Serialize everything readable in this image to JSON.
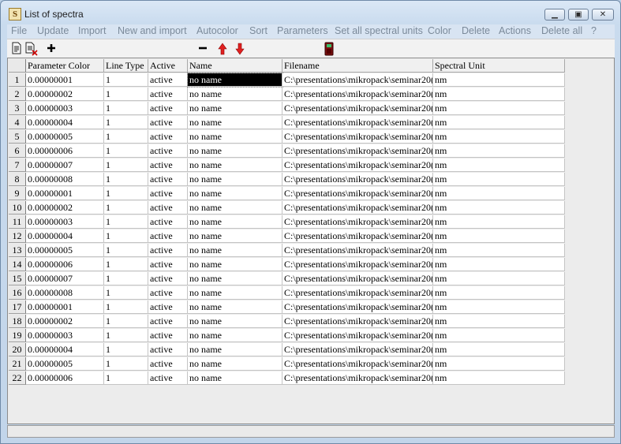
{
  "window": {
    "title": "List of spectra",
    "app_icon_letter": "S"
  },
  "menu": [
    "File",
    "Update",
    "Import",
    "New and import",
    "Autocolor",
    "Sort",
    "Parameters",
    "Set all spectral units",
    "Color",
    "Delete",
    "Actions",
    "Delete all",
    "?"
  ],
  "toolbar": {
    "icons": [
      "new-document-icon",
      "delete-document-icon",
      "add-icon",
      "remove-icon",
      "move-up-icon",
      "move-down-icon",
      "calculator-icon"
    ]
  },
  "table": {
    "headers": [
      "Parameter Color",
      "Line Type",
      "Active",
      "Name",
      "Filename",
      "Spectral Unit"
    ],
    "rows": [
      [
        "1",
        "0.00000001",
        "1",
        "active",
        "no name",
        "C:\\presentations\\mikropack\\seminar20(",
        "nm"
      ],
      [
        "2",
        "0.00000002",
        "1",
        "active",
        "no name",
        "C:\\presentations\\mikropack\\seminar20(",
        "nm"
      ],
      [
        "3",
        "0.00000003",
        "1",
        "active",
        "no name",
        "C:\\presentations\\mikropack\\seminar20(",
        "nm"
      ],
      [
        "4",
        "0.00000004",
        "1",
        "active",
        "no name",
        "C:\\presentations\\mikropack\\seminar20(",
        "nm"
      ],
      [
        "5",
        "0.00000005",
        "1",
        "active",
        "no name",
        "C:\\presentations\\mikropack\\seminar20(",
        "nm"
      ],
      [
        "6",
        "0.00000006",
        "1",
        "active",
        "no name",
        "C:\\presentations\\mikropack\\seminar20(",
        "nm"
      ],
      [
        "7",
        "0.00000007",
        "1",
        "active",
        "no name",
        "C:\\presentations\\mikropack\\seminar20(",
        "nm"
      ],
      [
        "8",
        "0.00000008",
        "1",
        "active",
        "no name",
        "C:\\presentations\\mikropack\\seminar20(",
        "nm"
      ],
      [
        "9",
        "0.00000001",
        "1",
        "active",
        "no name",
        "C:\\presentations\\mikropack\\seminar20(",
        "nm"
      ],
      [
        "10",
        "0.00000002",
        "1",
        "active",
        "no name",
        "C:\\presentations\\mikropack\\seminar20(",
        "nm"
      ],
      [
        "11",
        "0.00000003",
        "1",
        "active",
        "no name",
        "C:\\presentations\\mikropack\\seminar20(",
        "nm"
      ],
      [
        "12",
        "0.00000004",
        "1",
        "active",
        "no name",
        "C:\\presentations\\mikropack\\seminar20(",
        "nm"
      ],
      [
        "13",
        "0.00000005",
        "1",
        "active",
        "no name",
        "C:\\presentations\\mikropack\\seminar20(",
        "nm"
      ],
      [
        "14",
        "0.00000006",
        "1",
        "active",
        "no name",
        "C:\\presentations\\mikropack\\seminar20(",
        "nm"
      ],
      [
        "15",
        "0.00000007",
        "1",
        "active",
        "no name",
        "C:\\presentations\\mikropack\\seminar20(",
        "nm"
      ],
      [
        "16",
        "0.00000008",
        "1",
        "active",
        "no name",
        "C:\\presentations\\mikropack\\seminar20(",
        "nm"
      ],
      [
        "17",
        "0.00000001",
        "1",
        "active",
        "no name",
        "C:\\presentations\\mikropack\\seminar20(",
        "nm"
      ],
      [
        "18",
        "0.00000002",
        "1",
        "active",
        "no name",
        "C:\\presentations\\mikropack\\seminar20(",
        "nm"
      ],
      [
        "19",
        "0.00000003",
        "1",
        "active",
        "no name",
        "C:\\presentations\\mikropack\\seminar20(",
        "nm"
      ],
      [
        "20",
        "0.00000004",
        "1",
        "active",
        "no name",
        "C:\\presentations\\mikropack\\seminar20(",
        "nm"
      ],
      [
        "21",
        "0.00000005",
        "1",
        "active",
        "no name",
        "C:\\presentations\\mikropack\\seminar20(",
        "nm"
      ],
      [
        "22",
        "0.00000006",
        "1",
        "active",
        "no name",
        "C:\\presentations\\mikropack\\seminar20(",
        "nm"
      ]
    ],
    "selected_row": 1,
    "selected_column": "Name"
  },
  "colors": {
    "menu_disabled": "#7b8a9a",
    "selection": "#000000",
    "move_arrows": "#e02020"
  }
}
